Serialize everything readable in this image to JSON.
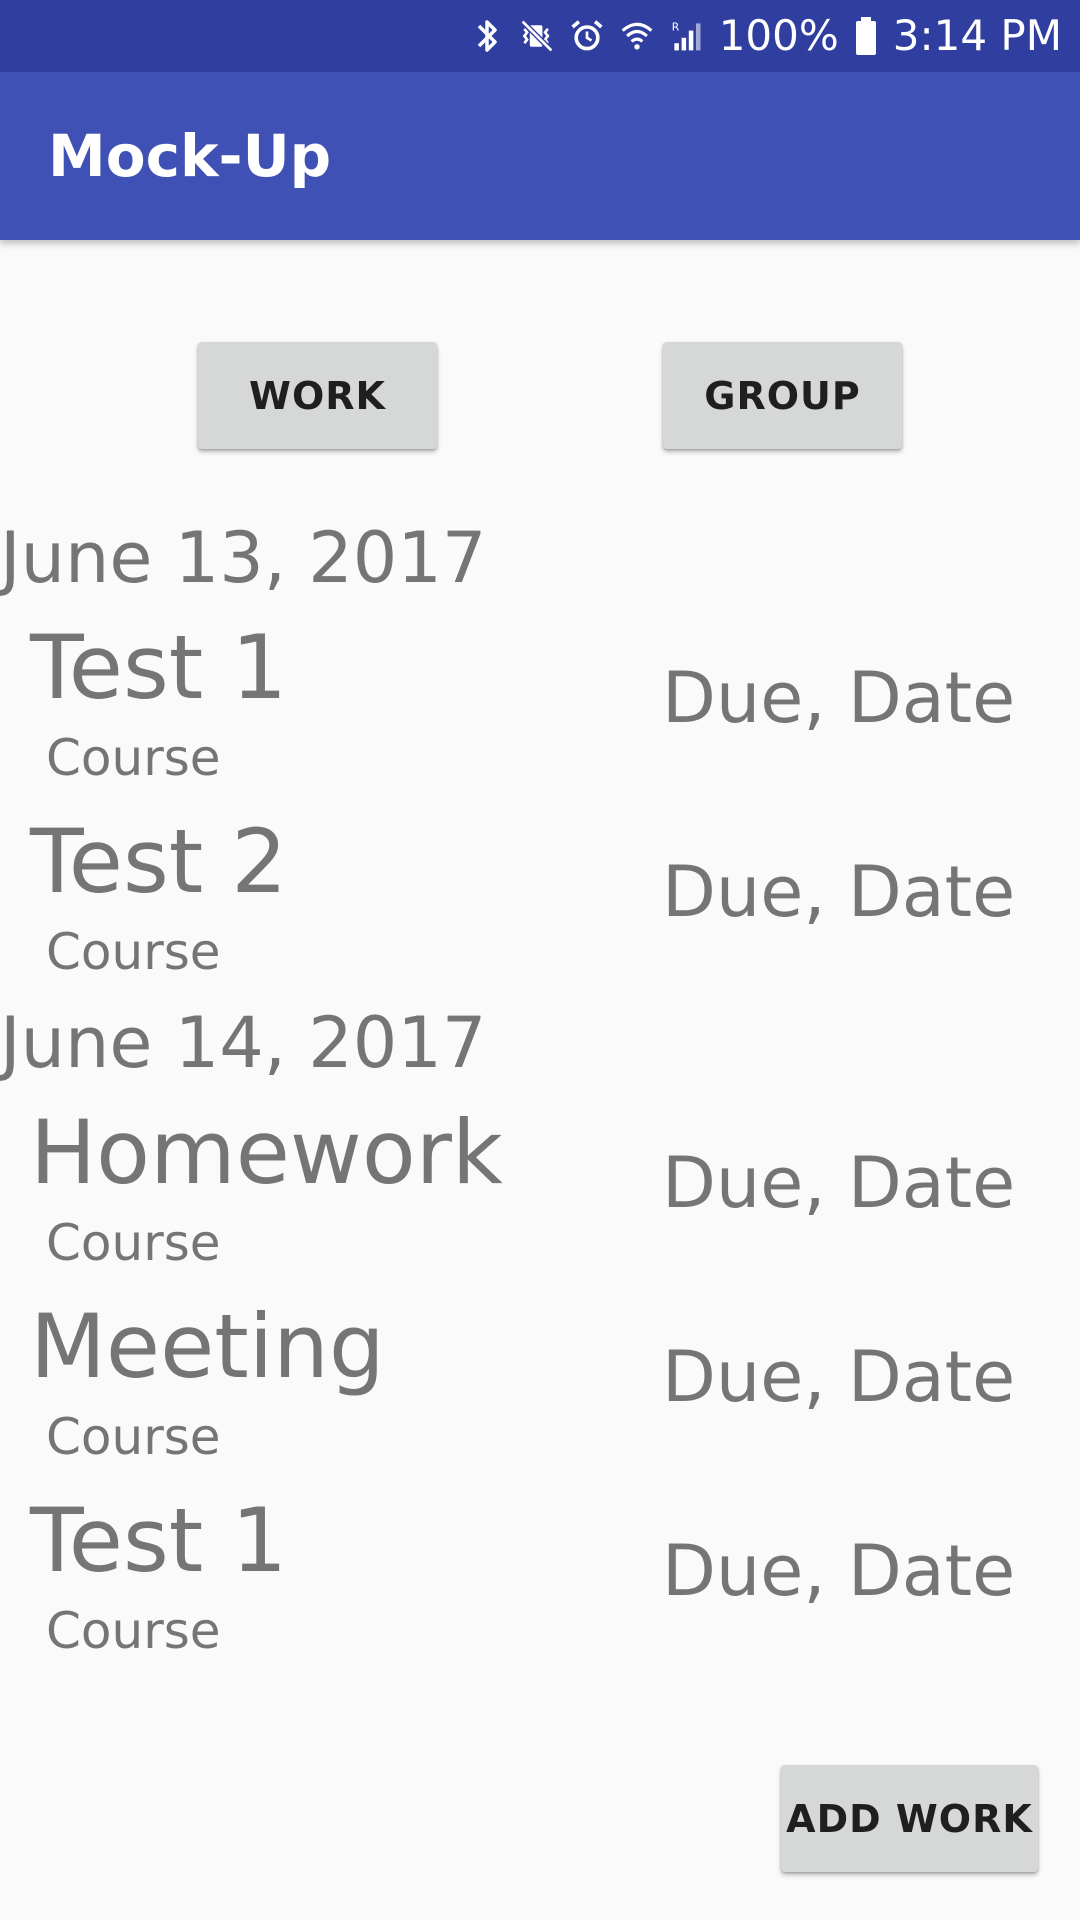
{
  "status_bar": {
    "battery": "100%",
    "time": "3:14 PM",
    "icons": [
      "bluetooth-icon",
      "vibrate-mute-icon",
      "alarm-icon",
      "wifi-icon",
      "signal-roaming-icon",
      "battery-icon"
    ]
  },
  "app_bar": {
    "title": "Mock-Up",
    "color": "#3f51b5",
    "status_color": "#303f9f"
  },
  "toolbar": {
    "work_label": "WORK",
    "group_label": "GROUP"
  },
  "sections": [
    {
      "date": "June 13, 2017",
      "items": [
        {
          "title": "Test 1",
          "course": "Course",
          "due": "Due, Date"
        },
        {
          "title": "Test 2",
          "course": "Course",
          "due": "Due, Date"
        }
      ]
    },
    {
      "date": "June 14, 2017",
      "items": [
        {
          "title": "Homework",
          "course": "Course",
          "due": "Due, Date"
        },
        {
          "title": "Meeting",
          "course": "Course",
          "due": "Due, Date"
        },
        {
          "title": "Test 1",
          "course": "Course",
          "due": "Due, Date"
        }
      ]
    }
  ],
  "footer": {
    "add_work_label": "ADD WORK"
  }
}
